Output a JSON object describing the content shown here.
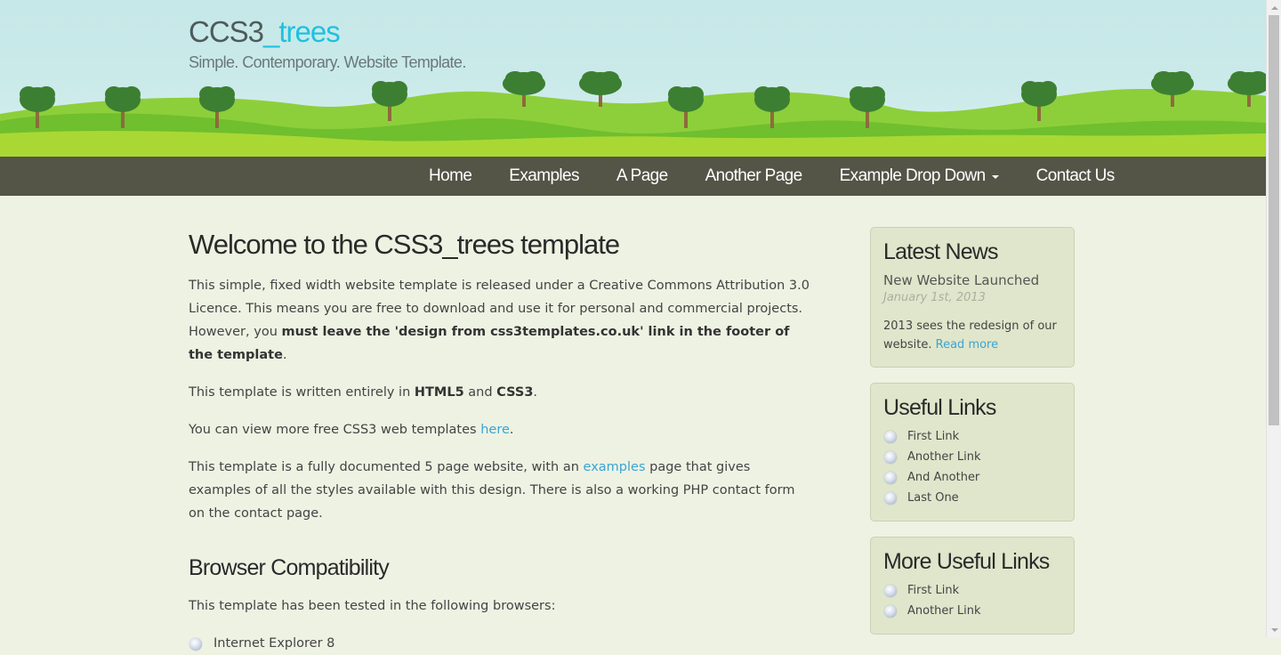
{
  "header": {
    "logo_main": "CCS3",
    "logo_accent": "_trees",
    "slogan": "Simple. Contemporary. Website Template."
  },
  "nav": {
    "items": [
      {
        "label": "Home"
      },
      {
        "label": "Examples"
      },
      {
        "label": "A Page"
      },
      {
        "label": "Another Page"
      },
      {
        "label": "Example Drop Down",
        "has_dropdown": true
      },
      {
        "label": "Contact Us"
      }
    ]
  },
  "content": {
    "title": "Welcome to the CSS3_trees template",
    "p1_a": "This simple, fixed width website template is released under a Creative Commons Attribution 3.0 Licence. This means you are free to download and use it for personal and commercial projects. However, you ",
    "p1_strong": "must leave the 'design from css3templates.co.uk' link in the footer of the template",
    "p1_end": ".",
    "p2_a": "This template is written entirely in ",
    "p2_b1": "HTML5",
    "p2_and": " and ",
    "p2_b2": "CSS3",
    "p2_end": ".",
    "p3_a": "You can view more free CSS3 web templates ",
    "p3_link": "here",
    "p3_end": ".",
    "p4_a": "This template is a fully documented 5 page website, with an ",
    "p4_link": "examples",
    "p4_b": " page that gives examples of all the styles available with this design. There is also a working PHP contact form on the contact page.",
    "h2": "Browser Compatibility",
    "p5": "This template has been tested in the following browsers:",
    "browsers": [
      "Internet Explorer 8"
    ]
  },
  "sidebar": {
    "news": {
      "title": "Latest News",
      "item_title": "New Website Launched",
      "item_date": "January 1st, 2013",
      "item_body": "2013 sees the redesign of our website. ",
      "read_more": "Read more"
    },
    "useful": {
      "title": "Useful Links",
      "links": [
        "First Link",
        "Another Link",
        "And Another",
        "Last One"
      ]
    },
    "more_useful": {
      "title": "More Useful Links",
      "links": [
        "First Link",
        "Another Link"
      ]
    }
  },
  "colors": {
    "accent": "#1ec1e0",
    "nav_bg": "#545547",
    "page_bg": "#eef2e3",
    "link": "#3aa4d1",
    "sidebar_box": "#dfe6cb"
  }
}
